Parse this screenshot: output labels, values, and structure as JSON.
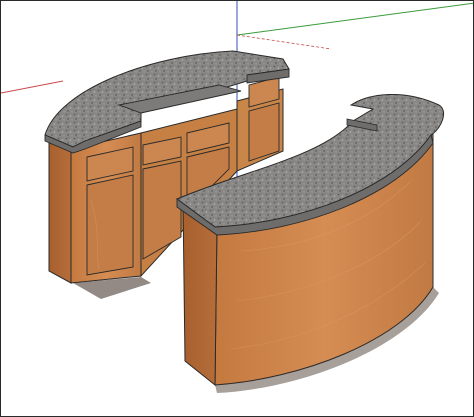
{
  "viewport": {
    "label": "",
    "background": "#ffffff"
  },
  "scene": {
    "model": "curved-reception-desk",
    "icons": [
      "red-axis-icon",
      "green-axis-icon",
      "blue-axis-icon"
    ]
  },
  "colors": {
    "axis_red": "#c84a4a",
    "axis_green": "#3a9a3a",
    "axis_blue": "#3050b0",
    "wood_light": "#d9915a",
    "wood_mid": "#c27a44",
    "wood_dark": "#9c5a2c",
    "granite": "#8c8a88",
    "granite_edge": "#6f6d6b",
    "outline": "#2a2a2a"
  }
}
